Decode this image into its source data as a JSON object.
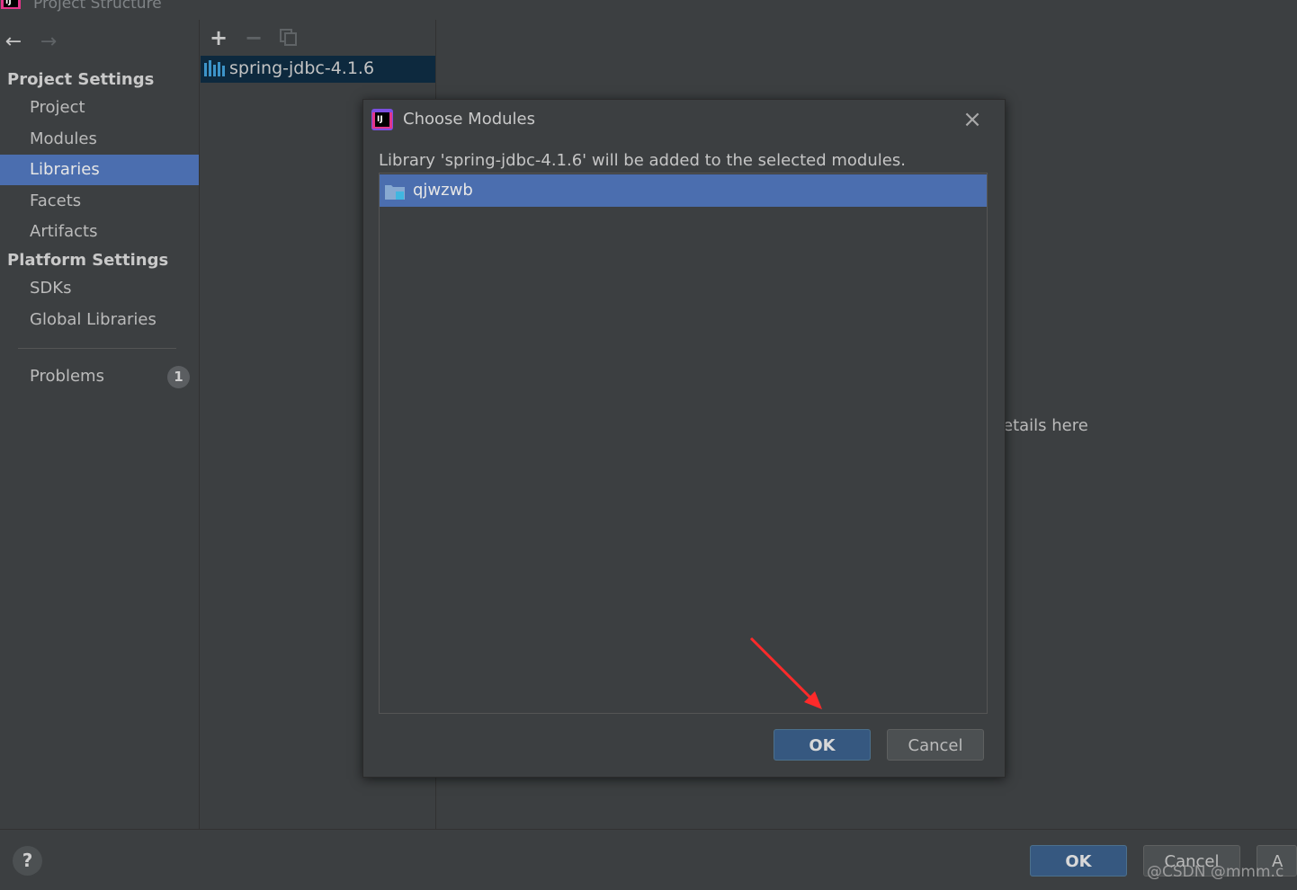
{
  "window": {
    "title": "Project Structure",
    "logo_icon": "intellij-logo-icon"
  },
  "nav": {
    "back_icon": "arrow-left-icon",
    "forward_icon": "arrow-right-icon"
  },
  "sidebar": {
    "project_settings_header": "Project Settings",
    "project_items": [
      {
        "label": "Project"
      },
      {
        "label": "Modules"
      },
      {
        "label": "Libraries",
        "selected": true
      },
      {
        "label": "Facets"
      },
      {
        "label": "Artifacts"
      }
    ],
    "platform_settings_header": "Platform Settings",
    "platform_items": [
      {
        "label": "SDKs"
      },
      {
        "label": "Global Libraries"
      }
    ],
    "problems_label": "Problems",
    "problems_count": "1"
  },
  "toolbar": {
    "add_icon": "plus-icon",
    "remove_icon": "minus-icon",
    "copy_icon": "copy-icon"
  },
  "libraries": {
    "items": [
      {
        "label": "spring-jdbc-4.1.6",
        "icon": "library-icon",
        "selected": true
      }
    ]
  },
  "details": {
    "hint": "etails here"
  },
  "dialog": {
    "title": "Choose Modules",
    "message": "Library 'spring-jdbc-4.1.6' will be added to the selected modules.",
    "modules": [
      {
        "label": "qjwzwb",
        "icon": "module-folder-icon",
        "selected": true
      }
    ],
    "ok_label": "OK",
    "cancel_label": "Cancel",
    "annotation": "red-arrow-pointing-to-ok"
  },
  "footer": {
    "help_label": "?",
    "ok_label": "OK",
    "cancel_label": "Cancel",
    "apply_label": "A",
    "watermark": "@CSDN @mmm.c"
  },
  "colors": {
    "background": "#3c3f41",
    "selection": "#4b6eaf",
    "primary_button": "#365880",
    "annotation_arrow": "#ff2a2a"
  }
}
